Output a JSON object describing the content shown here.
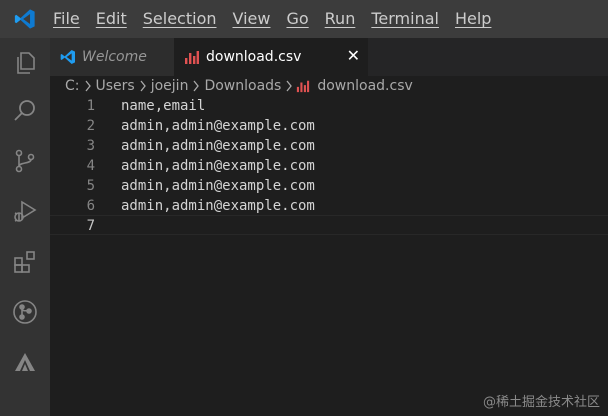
{
  "menu": [
    "File",
    "Edit",
    "Selection",
    "View",
    "Go",
    "Run",
    "Terminal",
    "Help"
  ],
  "tabs": [
    {
      "label": "Welcome",
      "icon": "vscode-logo-icon"
    },
    {
      "label": "download.csv",
      "icon": "csv-file-icon",
      "close": "✕"
    }
  ],
  "breadcrumb": [
    "C:",
    "Users",
    "joejin",
    "Downloads",
    "download.csv"
  ],
  "editor": {
    "lines": [
      {
        "num": "1",
        "text": "name,email"
      },
      {
        "num": "2",
        "text": "admin,admin@example.com"
      },
      {
        "num": "3",
        "text": "admin,admin@example.com"
      },
      {
        "num": "4",
        "text": "admin,admin@example.com"
      },
      {
        "num": "5",
        "text": "admin,admin@example.com"
      },
      {
        "num": "6",
        "text": "admin,admin@example.com"
      },
      {
        "num": "7",
        "text": ""
      }
    ]
  },
  "activity_icons": [
    "explorer-icon",
    "search-icon",
    "source-control-icon",
    "run-debug-icon",
    "extensions-icon",
    "git-graph-icon",
    "deploy-icon"
  ],
  "watermark": "@稀土掘金技术社区",
  "colors": {
    "accent": "#0078d4",
    "csv_icon": "#e05252",
    "background": "#1e1e1e"
  }
}
